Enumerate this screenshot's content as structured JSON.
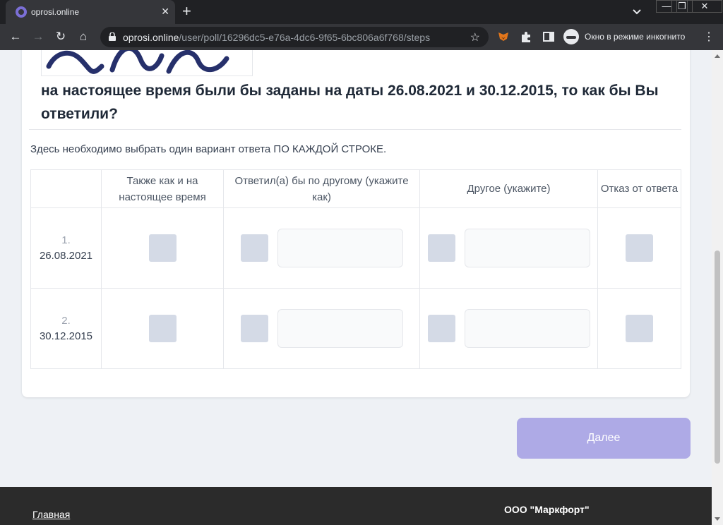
{
  "browser": {
    "tab_title": "oprosi.online",
    "tab_close": "✕",
    "new_tab": "+",
    "url_host": "oprosi.online",
    "url_path": "/user/poll/16296dc5-e76a-4dc6-9f65-6bc806a6f768/steps",
    "incognito_label": "Окно в режиме инкогнито",
    "window_controls": [
      "—",
      "❐",
      "✕"
    ],
    "nav": {
      "back": "←",
      "forward": "→",
      "reload": "↻",
      "home": "⌂"
    },
    "star": "☆",
    "menu": "⋮"
  },
  "poll": {
    "question": "на настоящее время были бы заданы на даты 26.08.2021 и 30.12.2015, то как бы Вы ответили?",
    "hint": "Здесь необходимо выбрать один вариант ответа ПО КАЖДОЙ СТРОКЕ.",
    "columns": [
      "",
      "Также как и на настоящее время",
      "Ответил(а) бы по другому (укажите как)",
      "Другое (укажите)",
      "Отказ от ответа"
    ],
    "rows": [
      {
        "num": "1.",
        "date": "26.08.2021"
      },
      {
        "num": "2.",
        "date": "30.12.2015"
      }
    ],
    "next_button": "Далее"
  },
  "footer": {
    "home_link": "Главная",
    "company": "ООО \"Маркфорт\""
  },
  "colors": {
    "accent": "#aeaae6",
    "checkbox": "#d4dae6",
    "footer_bg": "#2b2b2b",
    "page_bg": "#eef1f5"
  }
}
